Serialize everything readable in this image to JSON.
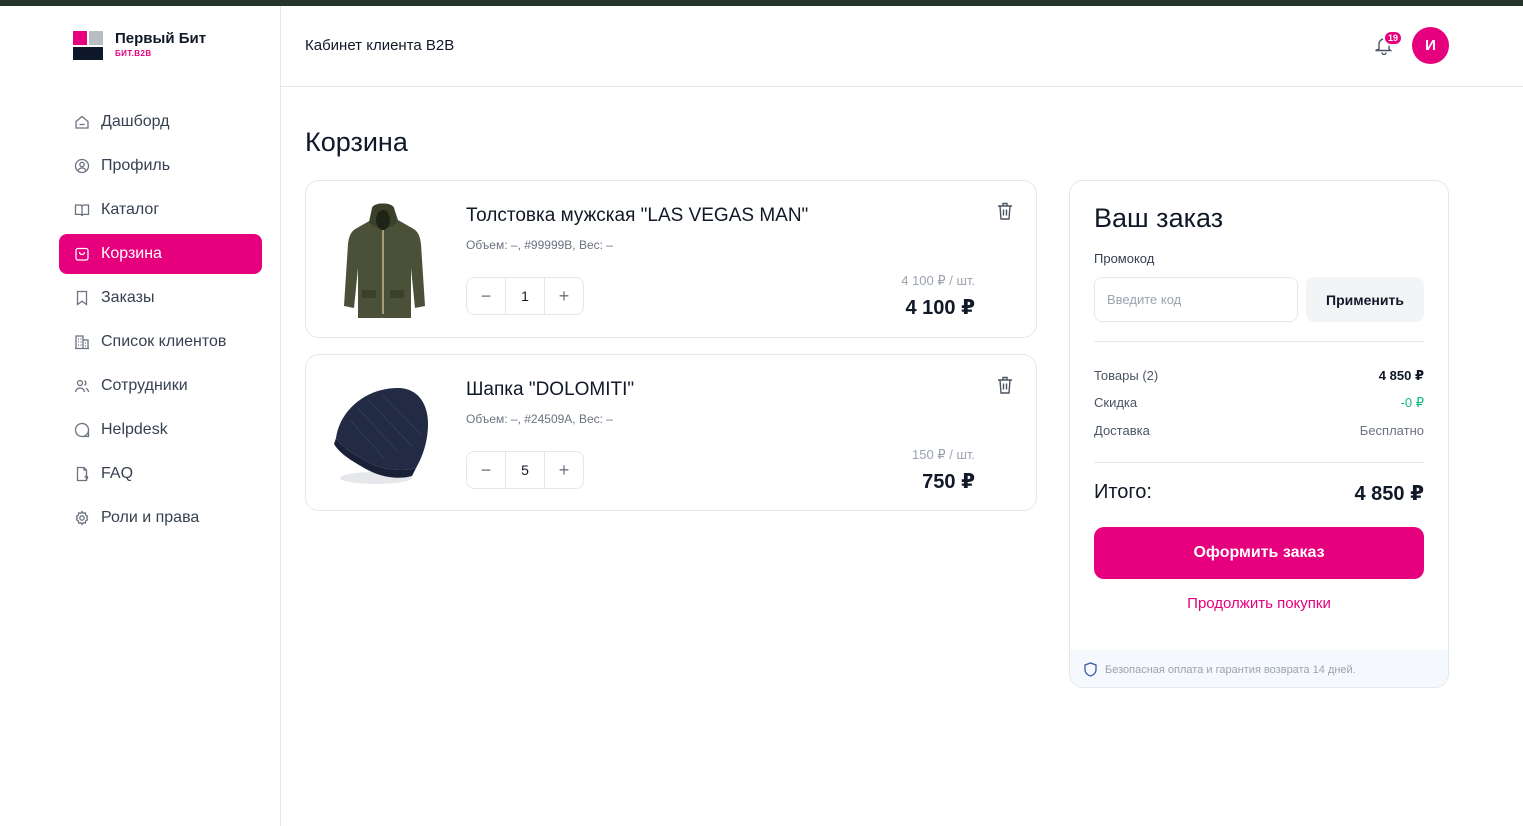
{
  "brand": {
    "name": "Первый Бит",
    "sub": "БИТ.B2B"
  },
  "header": {
    "title": "Кабинет клиента B2B",
    "notifications": "19",
    "avatar": "И"
  },
  "nav": [
    {
      "label": "Дашборд",
      "icon": "home-icon"
    },
    {
      "label": "Профиль",
      "icon": "user-circle-icon"
    },
    {
      "label": "Каталог",
      "icon": "book-open-icon"
    },
    {
      "label": "Корзина",
      "icon": "bag-icon",
      "active": true
    },
    {
      "label": "Заказы",
      "icon": "bookmark-icon"
    },
    {
      "label": "Список клиентов",
      "icon": "building-icon"
    },
    {
      "label": "Сотрудники",
      "icon": "users-icon"
    },
    {
      "label": "Helpdesk",
      "icon": "chat-icon"
    },
    {
      "label": "FAQ",
      "icon": "file-question-icon"
    },
    {
      "label": "Роли и права",
      "icon": "gear-icon"
    }
  ],
  "page": {
    "title": "Корзина"
  },
  "cart": {
    "items": [
      {
        "name": "Толстовка мужская \"LAS VEGAS MAN\"",
        "meta": "Объем: –, #99999B, Вес: –",
        "qty": "1",
        "unit_price": "4 100 ₽ / шт.",
        "total": "4 100 ₽",
        "image": "hoodie-image"
      },
      {
        "name": "Шапка \"DOLOMITI\"",
        "meta": "Объем: –, #24509A, Вес: –",
        "qty": "5",
        "unit_price": "150 ₽ / шт.",
        "total": "750 ₽",
        "image": "beanie-image"
      }
    ],
    "minus": "−",
    "plus": "+"
  },
  "summary": {
    "title": "Ваш заказ",
    "promo_label": "Промокод",
    "promo_placeholder": "Введите код",
    "promo_value": "",
    "apply": "Применить",
    "goods_label": "Товары (2)",
    "goods_value": "4 850 ₽",
    "discount_label": "Скидка",
    "discount_value": "-0 ₽",
    "delivery_label": "Доставка",
    "delivery_value": "Бесплатно",
    "total_label": "Итого:",
    "total_value": "4 850 ₽",
    "checkout": "Оформить заказ",
    "continue": "Продолжить покупки",
    "secure_note": "Безопасная оплата и гарантия возврата 14 дней."
  },
  "colors": {
    "accent": "#e6007e",
    "topbar": "#24362b",
    "success": "#10b981"
  }
}
